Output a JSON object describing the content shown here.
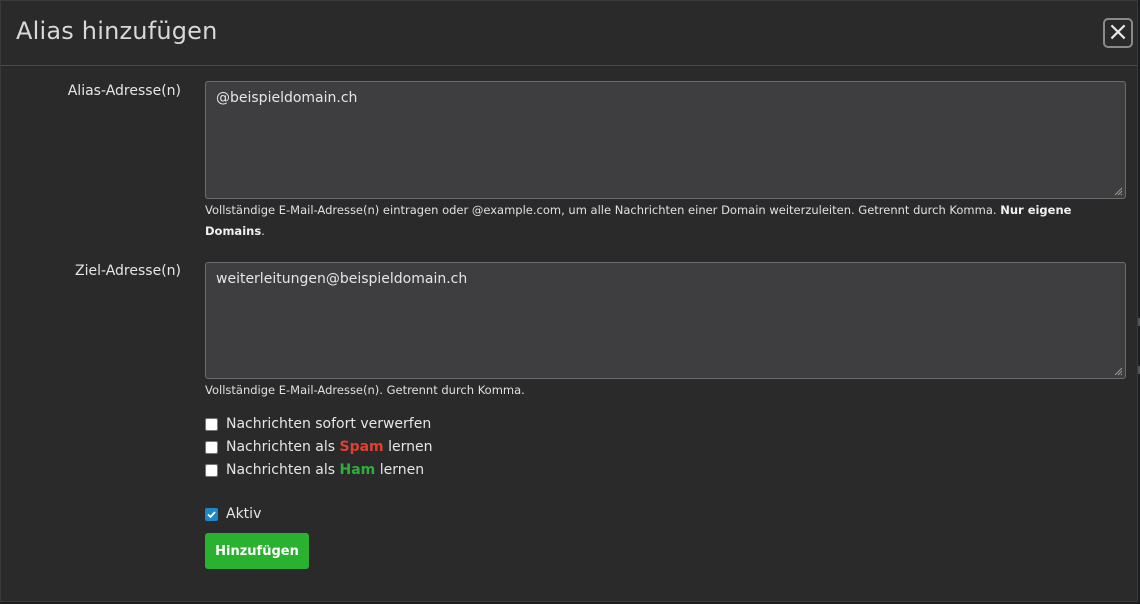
{
  "modal": {
    "title": "Alias hinzufügen",
    "close_label": "×"
  },
  "alias_field": {
    "label": "Alias-Adresse(n)",
    "value": "@beispieldomain.ch",
    "help_text": "Vollständige E-Mail-Adresse(n) eintragen oder @example.com, um alle Nachrichten einer Domain weiterzuleiten. Getrennt durch Komma.",
    "help_bold_1": "Nur eigene",
    "help_bold_2": "Domains",
    "help_suffix": "."
  },
  "target_field": {
    "label": "Ziel-Adresse(n)",
    "value": "weiterleitungen@beispieldomain.ch",
    "help_text": "Vollständige E-Mail-Adresse(n). Getrennt durch Komma."
  },
  "options": {
    "discard": {
      "label": "Nachrichten sofort verwerfen",
      "checked": false
    },
    "spam": {
      "prefix": "Nachrichten als",
      "keyword": "Spam",
      "suffix": "lernen",
      "checked": false
    },
    "ham": {
      "prefix": "Nachrichten als",
      "keyword": "Ham",
      "suffix": "lernen",
      "checked": false
    },
    "active": {
      "label": "Aktiv",
      "checked": true
    }
  },
  "submit_label": "Hinzufügen",
  "colors": {
    "spam": "#e2402f",
    "ham": "#2eae3a",
    "button": "#2bb130",
    "checkbox_active": "#1e87c8"
  }
}
